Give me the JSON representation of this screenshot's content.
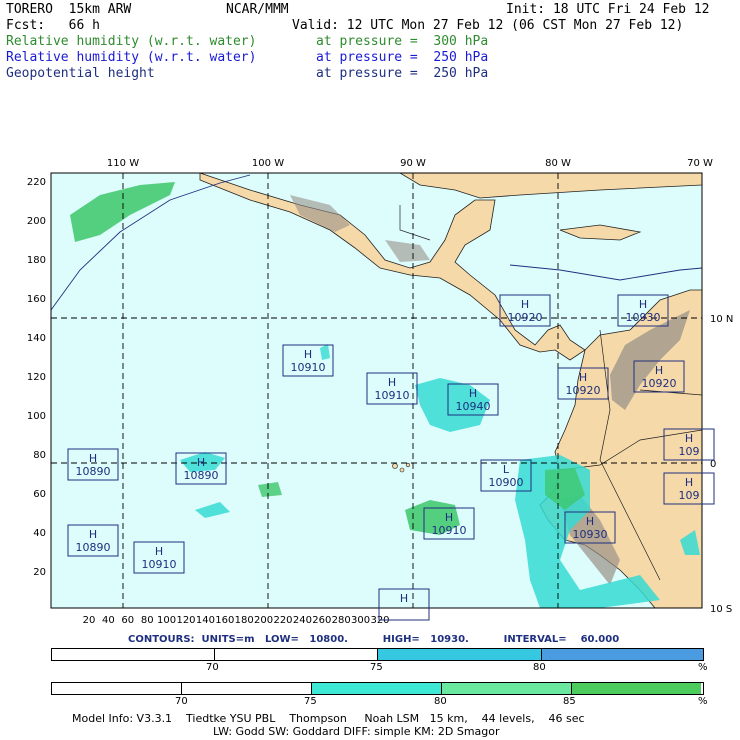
{
  "header": {
    "model": "TORERO  15km ARW",
    "org": "NCAR/MMM",
    "init": "Init: 18 UTC Fri 24 Feb 12",
    "fcst": "Fcst:   66 h",
    "valid": "Valid: 12 UTC Mon 27 Feb 12 (06 CST Mon 27 Feb 12)",
    "fields": [
      {
        "name": "Relative humidity (w.r.t. water)",
        "level": "at pressure =  300 hPa",
        "color": "#2e8b2e"
      },
      {
        "name": "Relative humidity (w.r.t. water)",
        "level": "at pressure =  250 hPa",
        "color": "#1a1ad6"
      },
      {
        "name": "Geopotential height",
        "level": "at pressure =  250 hPa",
        "color": "#1f2f7f"
      }
    ]
  },
  "map": {
    "lon_labels": [
      "110 W",
      "100 W",
      "90 W",
      "80 W",
      "70 W"
    ],
    "lat_labels": [
      "10 N",
      "0",
      "10 S"
    ],
    "y_ticks": [
      "220",
      "200",
      "180",
      "160",
      "140",
      "120",
      "100",
      "80",
      "60",
      "40",
      "20"
    ],
    "x_ticks": [
      "20",
      "40",
      "60",
      "80",
      "100",
      "120",
      "140",
      "160",
      "180",
      "200",
      "220",
      "240",
      "260",
      "280",
      "300",
      "320"
    ],
    "centers": [
      {
        "type": "H",
        "value": "10920"
      },
      {
        "type": "H",
        "value": "10930"
      },
      {
        "type": "H",
        "value": "10910"
      },
      {
        "type": "H",
        "value": "10910"
      },
      {
        "type": "H",
        "value": "10940"
      },
      {
        "type": "H",
        "value": "10920"
      },
      {
        "type": "H",
        "value": "10920"
      },
      {
        "type": "H",
        "value": "109"
      },
      {
        "type": "H",
        "value": "10890"
      },
      {
        "type": "H",
        "value": "10890"
      },
      {
        "type": "L",
        "value": "10900"
      },
      {
        "type": "H",
        "value": "109"
      },
      {
        "type": "H",
        "value": "10910"
      },
      {
        "type": "H",
        "value": "10930"
      },
      {
        "type": "H",
        "value": "10890"
      },
      {
        "type": "H",
        "value": "10910"
      },
      {
        "type": "H",
        "value": ""
      }
    ],
    "colors": {
      "ocean": "#ddfcfc",
      "land": "#f5d9a8",
      "mountain": "#9a9188",
      "rh_green": "#3cc76a",
      "rh_cyan": "#35dbd2"
    }
  },
  "contours": {
    "text": "CONTOURS:  UNITS=m   LOW=   10800.          HIGH=   10930.          INTERVAL=    60.000"
  },
  "colorbar1": {
    "labels": [
      "70",
      "75",
      "80",
      "%"
    ],
    "colors": [
      "#ffffff",
      "#ffffff",
      "#35c8e0",
      "#4b9be0"
    ]
  },
  "colorbar2": {
    "labels": [
      "70",
      "75",
      "80",
      "85",
      "%"
    ],
    "colors": [
      "#ffffff",
      "#ffffff",
      "#3de8d4",
      "#6ae8a0",
      "#4ccc5c"
    ]
  },
  "footer": {
    "line1": "Model Info: V3.3.1    Tiedtke YSU PBL    Thompson     Noah LSM   15 km,    44 levels,    46 sec",
    "line2": "LW: Godd SW: Goddard DIFF: simple KM: 2D Smagor"
  }
}
